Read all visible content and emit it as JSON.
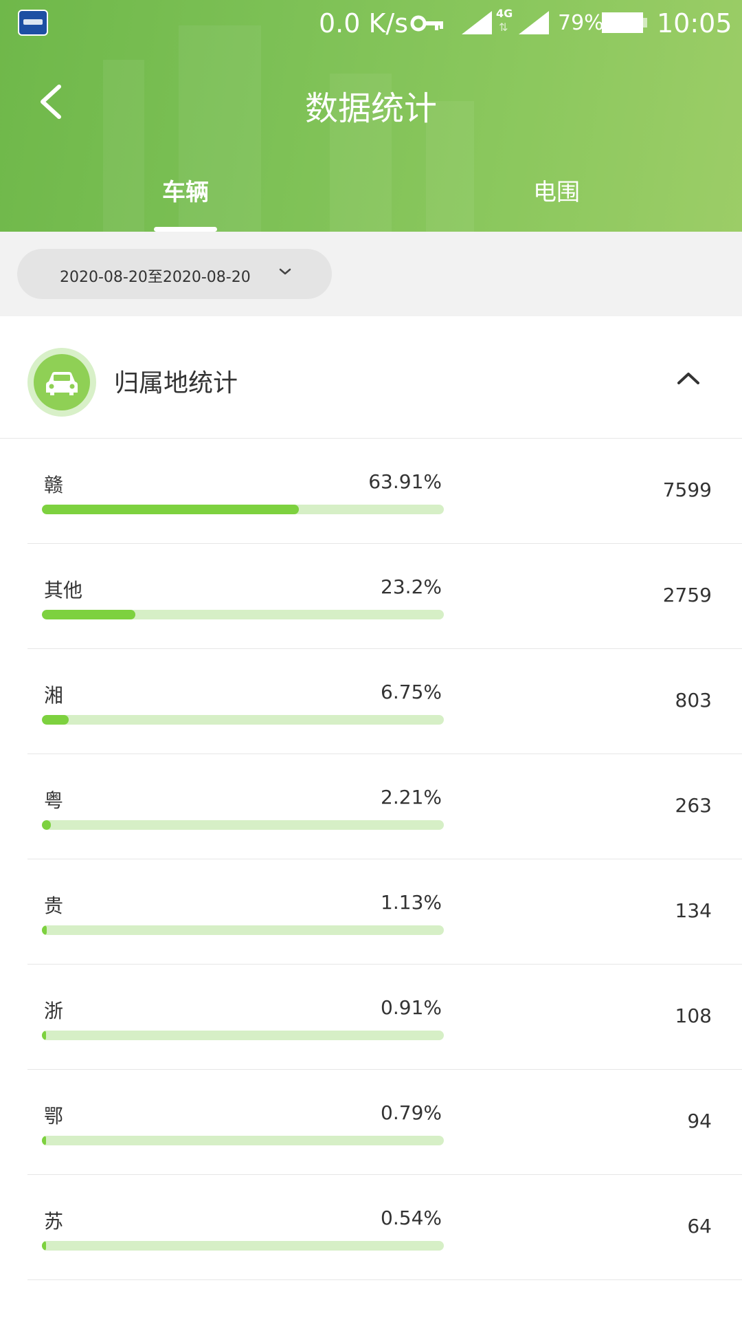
{
  "status_bar": {
    "net_speed": "0.0 K/s",
    "net_type": "4G",
    "battery": "79%",
    "time": "10:05"
  },
  "header": {
    "title": "数据统计",
    "tabs": [
      {
        "label": "车辆",
        "active": true
      },
      {
        "label": "电围",
        "active": false
      }
    ]
  },
  "filter": {
    "date_range": "2020-08-20至2020-08-20"
  },
  "section": {
    "title": "归属地统计",
    "icon": "car-icon"
  },
  "rows": [
    {
      "label": "赣",
      "percent": "63.91%",
      "fraction": 0.6391,
      "count": "7599"
    },
    {
      "label": "其他",
      "percent": "23.2%",
      "fraction": 0.232,
      "count": "2759"
    },
    {
      "label": "湘",
      "percent": "6.75%",
      "fraction": 0.0675,
      "count": "803"
    },
    {
      "label": "粤",
      "percent": "2.21%",
      "fraction": 0.0221,
      "count": "263"
    },
    {
      "label": "贵",
      "percent": "1.13%",
      "fraction": 0.0113,
      "count": "134"
    },
    {
      "label": "浙",
      "percent": "0.91%",
      "fraction": 0.0091,
      "count": "108"
    },
    {
      "label": "鄂",
      "percent": "0.79%",
      "fraction": 0.0079,
      "count": "94"
    },
    {
      "label": "苏",
      "percent": "0.54%",
      "fraction": 0.0054,
      "count": "64"
    }
  ],
  "colors": {
    "header_green": "#7cc055",
    "bar_fill": "#7dd13f",
    "bar_track": "#d6efc6"
  }
}
